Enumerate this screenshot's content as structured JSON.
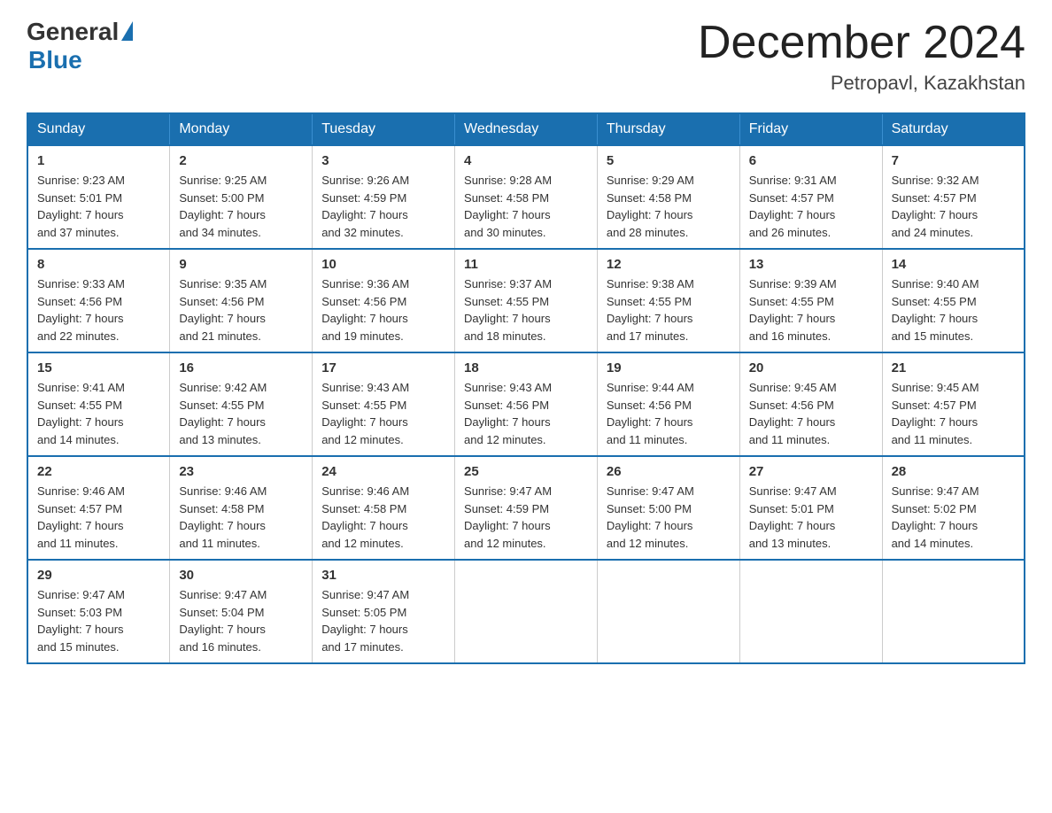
{
  "header": {
    "logo_general": "General",
    "logo_triangle": "▶",
    "logo_blue": "Blue",
    "title": "December 2024",
    "subtitle": "Petropavl, Kazakhstan"
  },
  "days_of_week": [
    "Sunday",
    "Monday",
    "Tuesday",
    "Wednesday",
    "Thursday",
    "Friday",
    "Saturday"
  ],
  "weeks": [
    [
      {
        "day": "1",
        "sunrise": "9:23 AM",
        "sunset": "5:01 PM",
        "daylight": "7 hours and 37 minutes."
      },
      {
        "day": "2",
        "sunrise": "9:25 AM",
        "sunset": "5:00 PM",
        "daylight": "7 hours and 34 minutes."
      },
      {
        "day": "3",
        "sunrise": "9:26 AM",
        "sunset": "4:59 PM",
        "daylight": "7 hours and 32 minutes."
      },
      {
        "day": "4",
        "sunrise": "9:28 AM",
        "sunset": "4:58 PM",
        "daylight": "7 hours and 30 minutes."
      },
      {
        "day": "5",
        "sunrise": "9:29 AM",
        "sunset": "4:58 PM",
        "daylight": "7 hours and 28 minutes."
      },
      {
        "day": "6",
        "sunrise": "9:31 AM",
        "sunset": "4:57 PM",
        "daylight": "7 hours and 26 minutes."
      },
      {
        "day": "7",
        "sunrise": "9:32 AM",
        "sunset": "4:57 PM",
        "daylight": "7 hours and 24 minutes."
      }
    ],
    [
      {
        "day": "8",
        "sunrise": "9:33 AM",
        "sunset": "4:56 PM",
        "daylight": "7 hours and 22 minutes."
      },
      {
        "day": "9",
        "sunrise": "9:35 AM",
        "sunset": "4:56 PM",
        "daylight": "7 hours and 21 minutes."
      },
      {
        "day": "10",
        "sunrise": "9:36 AM",
        "sunset": "4:56 PM",
        "daylight": "7 hours and 19 minutes."
      },
      {
        "day": "11",
        "sunrise": "9:37 AM",
        "sunset": "4:55 PM",
        "daylight": "7 hours and 18 minutes."
      },
      {
        "day": "12",
        "sunrise": "9:38 AM",
        "sunset": "4:55 PM",
        "daylight": "7 hours and 17 minutes."
      },
      {
        "day": "13",
        "sunrise": "9:39 AM",
        "sunset": "4:55 PM",
        "daylight": "7 hours and 16 minutes."
      },
      {
        "day": "14",
        "sunrise": "9:40 AM",
        "sunset": "4:55 PM",
        "daylight": "7 hours and 15 minutes."
      }
    ],
    [
      {
        "day": "15",
        "sunrise": "9:41 AM",
        "sunset": "4:55 PM",
        "daylight": "7 hours and 14 minutes."
      },
      {
        "day": "16",
        "sunrise": "9:42 AM",
        "sunset": "4:55 PM",
        "daylight": "7 hours and 13 minutes."
      },
      {
        "day": "17",
        "sunrise": "9:43 AM",
        "sunset": "4:55 PM",
        "daylight": "7 hours and 12 minutes."
      },
      {
        "day": "18",
        "sunrise": "9:43 AM",
        "sunset": "4:56 PM",
        "daylight": "7 hours and 12 minutes."
      },
      {
        "day": "19",
        "sunrise": "9:44 AM",
        "sunset": "4:56 PM",
        "daylight": "7 hours and 11 minutes."
      },
      {
        "day": "20",
        "sunrise": "9:45 AM",
        "sunset": "4:56 PM",
        "daylight": "7 hours and 11 minutes."
      },
      {
        "day": "21",
        "sunrise": "9:45 AM",
        "sunset": "4:57 PM",
        "daylight": "7 hours and 11 minutes."
      }
    ],
    [
      {
        "day": "22",
        "sunrise": "9:46 AM",
        "sunset": "4:57 PM",
        "daylight": "7 hours and 11 minutes."
      },
      {
        "day": "23",
        "sunrise": "9:46 AM",
        "sunset": "4:58 PM",
        "daylight": "7 hours and 11 minutes."
      },
      {
        "day": "24",
        "sunrise": "9:46 AM",
        "sunset": "4:58 PM",
        "daylight": "7 hours and 12 minutes."
      },
      {
        "day": "25",
        "sunrise": "9:47 AM",
        "sunset": "4:59 PM",
        "daylight": "7 hours and 12 minutes."
      },
      {
        "day": "26",
        "sunrise": "9:47 AM",
        "sunset": "5:00 PM",
        "daylight": "7 hours and 12 minutes."
      },
      {
        "day": "27",
        "sunrise": "9:47 AM",
        "sunset": "5:01 PM",
        "daylight": "7 hours and 13 minutes."
      },
      {
        "day": "28",
        "sunrise": "9:47 AM",
        "sunset": "5:02 PM",
        "daylight": "7 hours and 14 minutes."
      }
    ],
    [
      {
        "day": "29",
        "sunrise": "9:47 AM",
        "sunset": "5:03 PM",
        "daylight": "7 hours and 15 minutes."
      },
      {
        "day": "30",
        "sunrise": "9:47 AM",
        "sunset": "5:04 PM",
        "daylight": "7 hours and 16 minutes."
      },
      {
        "day": "31",
        "sunrise": "9:47 AM",
        "sunset": "5:05 PM",
        "daylight": "7 hours and 17 minutes."
      },
      null,
      null,
      null,
      null
    ]
  ],
  "labels": {
    "sunrise": "Sunrise:",
    "sunset": "Sunset:",
    "daylight": "Daylight:"
  }
}
